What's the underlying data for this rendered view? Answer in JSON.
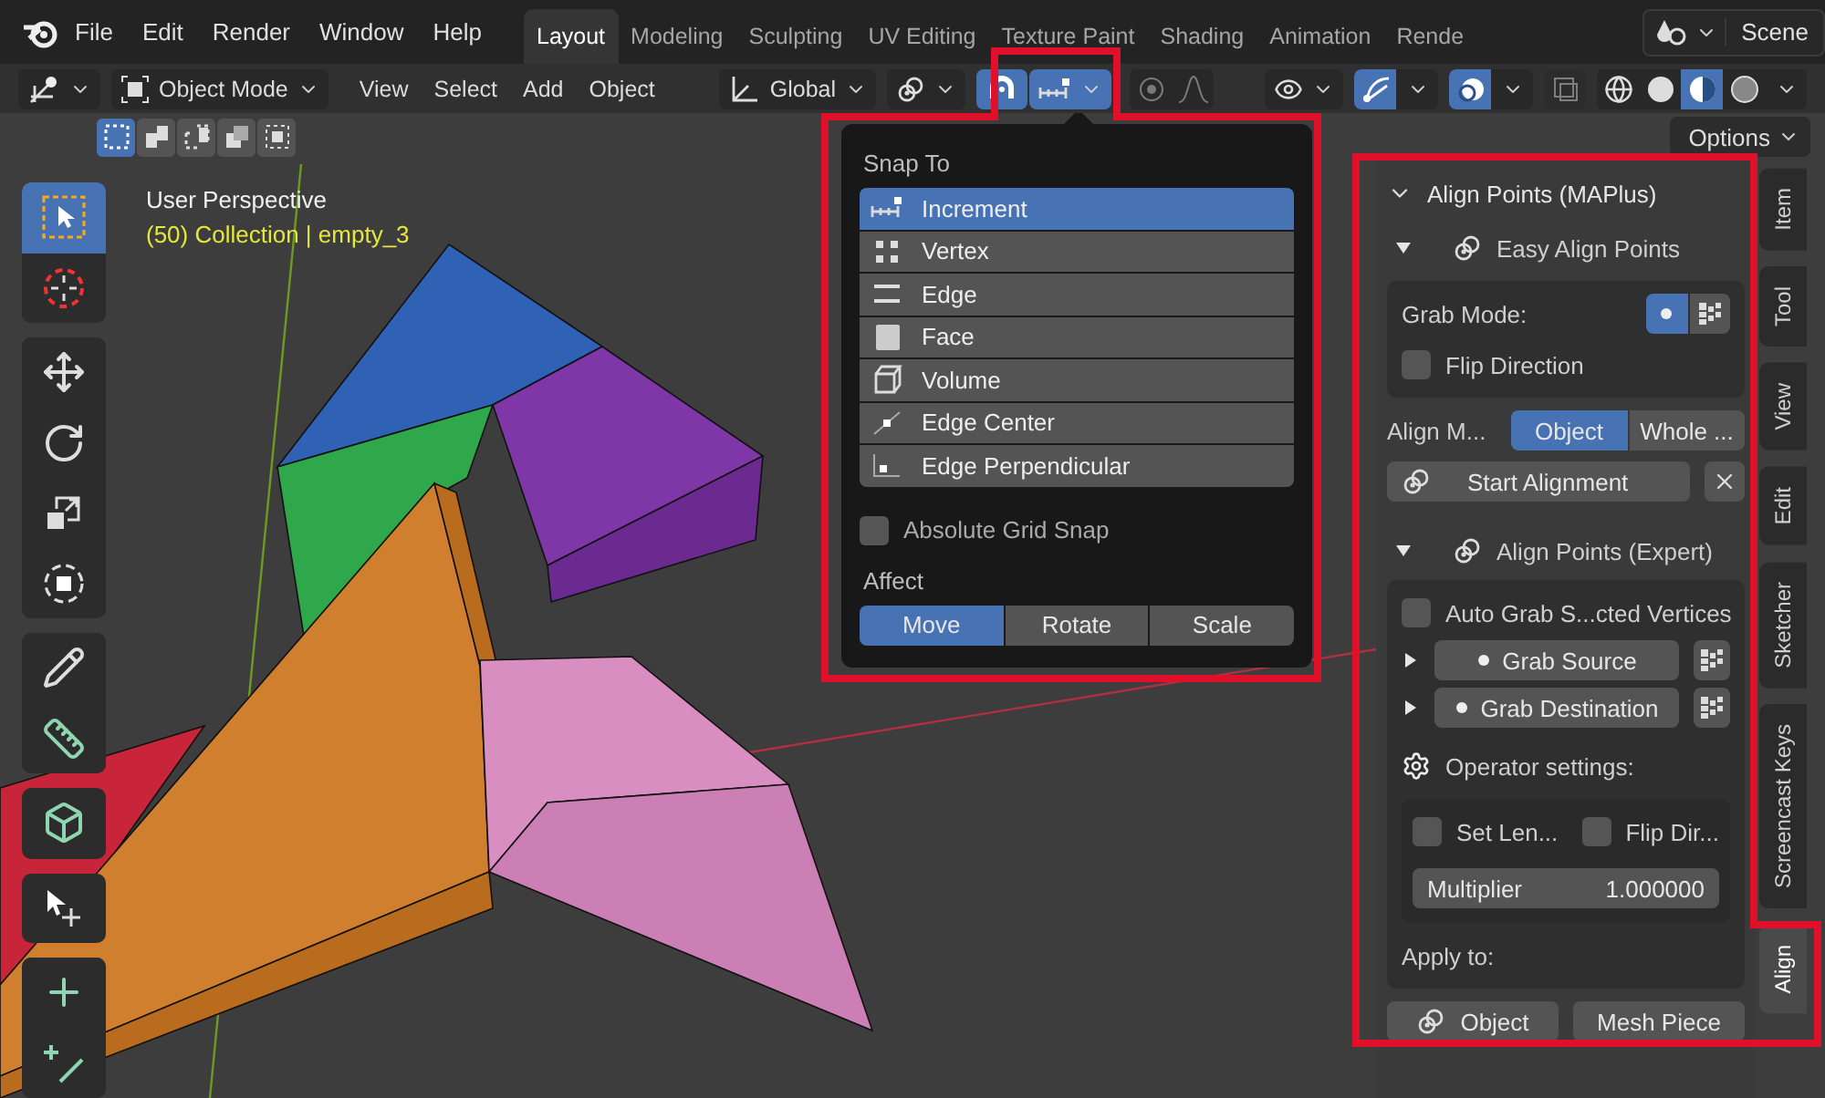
{
  "menu_bar": {
    "items": [
      "File",
      "Edit",
      "Render",
      "Window",
      "Help"
    ]
  },
  "workspace_tabs": [
    {
      "label": "Layout",
      "selected": true
    },
    {
      "label": "Modeling",
      "selected": false
    },
    {
      "label": "Sculpting",
      "selected": false
    },
    {
      "label": "UV Editing",
      "selected": false
    },
    {
      "label": "Texture Paint",
      "selected": false
    },
    {
      "label": "Shading",
      "selected": false
    },
    {
      "label": "Animation",
      "selected": false
    },
    {
      "label": "Rende",
      "selected": false
    }
  ],
  "scene": {
    "label": "Scene"
  },
  "header": {
    "mode": "Object Mode",
    "menus": [
      "View",
      "Select",
      "Add",
      "Object"
    ],
    "orientation": "Global",
    "snap": {
      "on": true
    },
    "proportional_editing": {
      "on": false
    },
    "gizmos": {
      "on": true
    },
    "overlays": {
      "on": true
    },
    "xray": {
      "on": false
    },
    "shading_modes": [
      {
        "selected": false
      },
      {
        "selected": false
      },
      {
        "selected": true
      },
      {
        "selected": false
      }
    ]
  },
  "select_modes": [
    {
      "selected": true
    },
    {
      "selected": false
    },
    {
      "selected": false
    },
    {
      "selected": false
    },
    {
      "selected": false
    }
  ],
  "options": {
    "label": "Options"
  },
  "toolbar": {
    "tools": [
      {
        "selected": true
      },
      {
        "selected": false
      },
      {
        "selected": false
      },
      {
        "selected": false
      },
      {
        "selected": false
      },
      {
        "selected": false
      },
      {
        "selected": false
      },
      {
        "selected": false
      },
      {
        "selected": false
      },
      {
        "selected": false
      },
      {
        "selected": false
      },
      {
        "selected": false
      }
    ]
  },
  "viewport": {
    "view_name": "User Perspective",
    "object_info": "(50) Collection | empty_3"
  },
  "snap_popup": {
    "title": "Snap To",
    "items": [
      {
        "label": "Increment",
        "selected": true
      },
      {
        "label": "Vertex",
        "selected": false
      },
      {
        "label": "Edge",
        "selected": false
      },
      {
        "label": "Face",
        "selected": false
      },
      {
        "label": "Volume",
        "selected": false
      },
      {
        "label": "Edge Center",
        "selected": false
      },
      {
        "label": "Edge Perpendicular",
        "selected": false
      }
    ],
    "absolute_grid_snap": {
      "label": "Absolute Grid Snap",
      "checked": false
    },
    "affect_label": "Affect",
    "affect": [
      {
        "label": "Move",
        "selected": true
      },
      {
        "label": "Rotate",
        "selected": false
      },
      {
        "label": "Scale",
        "selected": false
      }
    ]
  },
  "sidebar": {
    "panel_title": "Align Points (MAPlus)",
    "expanded": true,
    "easy": {
      "title": "Easy Align Points",
      "expanded": true,
      "grab_mode_label": "Grab Mode:",
      "grab_modes": [
        {
          "selected": true
        },
        {
          "selected": false
        }
      ],
      "flip": {
        "label": "Flip Direction",
        "checked": false
      },
      "align_mode_label": "Align M...",
      "align_modes": [
        {
          "label": "Object",
          "selected": true
        },
        {
          "label": "Whole ...",
          "selected": false
        }
      ],
      "start_label": "Start Alignment"
    },
    "expert": {
      "title": "Align Points (Expert)",
      "expanded": true,
      "auto_grab": {
        "label": "Auto Grab S...cted Vertices",
        "checked": false
      },
      "grabs": [
        {
          "label": "Grab Source",
          "expanded": false
        },
        {
          "label": "Grab Destination",
          "expanded": false
        }
      ],
      "operator_label": "Operator settings:",
      "set_length": {
        "label": "Set Len...",
        "checked": false
      },
      "flip_direction": {
        "label": "Flip Dir...",
        "checked": false
      },
      "multiplier": {
        "label": "Multiplier",
        "value": "1.000000"
      },
      "apply_label": "Apply to:",
      "apply_buttons": [
        "Object",
        "Mesh Piece"
      ]
    },
    "tabs": [
      {
        "label": "Item",
        "selected": false
      },
      {
        "label": "Tool",
        "selected": false
      },
      {
        "label": "View",
        "selected": false
      },
      {
        "label": "Edit",
        "selected": false
      },
      {
        "label": "Sketcher",
        "selected": false
      },
      {
        "label": "Screencast Keys",
        "selected": false
      },
      {
        "label": "Align",
        "selected": true
      }
    ]
  }
}
